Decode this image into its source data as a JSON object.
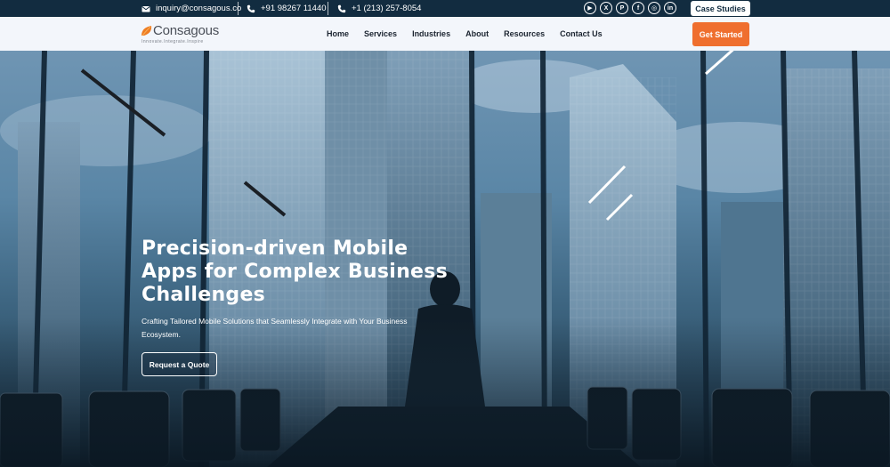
{
  "topbar": {
    "email": "inquiry@consagous.co",
    "phone_in": "+91 98267 11440",
    "phone_us": "+1 (213) 257-8054",
    "socials": [
      {
        "name": "youtube-icon",
        "glyph": "▶"
      },
      {
        "name": "x-icon",
        "glyph": "X"
      },
      {
        "name": "pinterest-icon",
        "glyph": "P"
      },
      {
        "name": "facebook-icon",
        "glyph": "f"
      },
      {
        "name": "instagram-icon",
        "glyph": "◎"
      },
      {
        "name": "linkedin-icon",
        "glyph": "in"
      }
    ],
    "case_studies_label": "Case Studies"
  },
  "header": {
    "logo_name": "Consagous",
    "logo_tagline": "Innovate.Integrate.Inspire",
    "nav": [
      "Home",
      "Services",
      "Industries",
      "About",
      "Resources",
      "Contact Us"
    ],
    "cta_label": "Get Started"
  },
  "hero": {
    "title": "Precision-driven Mobile Apps for Complex Business Challenges",
    "subtitle": "Crafting Tailored Mobile Solutions that Seamlessly Integrate with Your Business Ecosystem.",
    "button_label": "Request a Quote"
  },
  "colors": {
    "topbar_bg": "#122c40",
    "header_bg": "#f3f6fb",
    "accent": "#ef6f2e"
  }
}
